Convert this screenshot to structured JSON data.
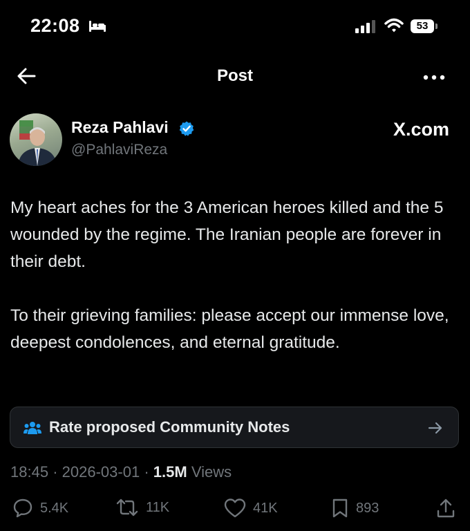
{
  "status_bar": {
    "time": "22:08",
    "battery": "53"
  },
  "header": {
    "title": "Post"
  },
  "author": {
    "name": "Reza Pahlavi",
    "handle": "@PahlaviReza",
    "source": "X.com"
  },
  "post": {
    "paragraphs": [
      "My heart aches for the 3 American heroes killed and the 5 wounded by the regime. The Iranian people are forever in their debt.",
      "To their grieving families: please accept our immense love, deepest condolences, and eternal gratitude."
    ]
  },
  "community_notes": {
    "label": "Rate proposed Community Notes"
  },
  "meta": {
    "time": "18:45",
    "separator": "·",
    "date": "2026-03-01",
    "views_count": "1.5M",
    "views_label": "Views"
  },
  "actions": {
    "replies": "5.4K",
    "reposts": "11K",
    "likes": "41K",
    "bookmarks": "893"
  },
  "colors": {
    "background": "#000000",
    "text": "#e7e9ea",
    "muted": "#71767b",
    "verified": "#1d9bf0",
    "notes_icon": "#1d9bf0"
  }
}
